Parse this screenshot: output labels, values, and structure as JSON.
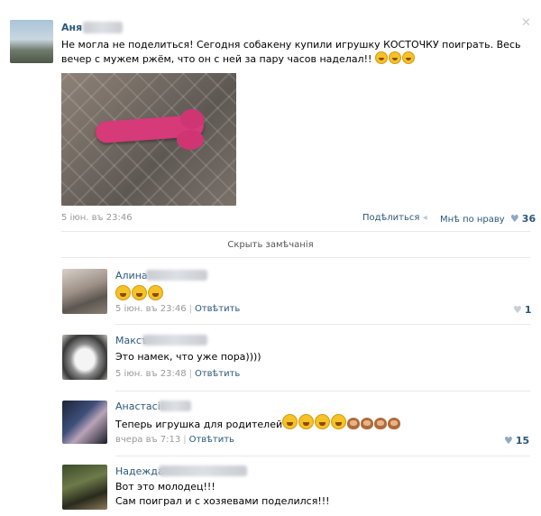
{
  "post": {
    "author": "Аня",
    "text": "Не могла не поделиться! Сегодня собакену купили игрушку КОСТОЧКУ поиграть. Весь вечер с мужем ржём, что он с ней за пару часов наделал!!",
    "emoji_icons": [
      "laughing-emoji",
      "laughing-emoji",
      "laughing-emoji"
    ],
    "date": "5 іюн. въ 23:46",
    "share_label": "Подѣлиться",
    "like_label": "Мнѣ по нраву",
    "like_count": "36",
    "hide_comments": "Скрыть замѣчанія",
    "close_icon": "✕"
  },
  "comments": [
    {
      "name": "Алина",
      "text": "",
      "emoji_count": 3,
      "date": "5 іюн. въ 23:46",
      "reply": "Отвѣтить",
      "likes": "1"
    },
    {
      "name": "Максъ",
      "text": "Это намек, что уже пора))))",
      "date": "5 іюн. въ 23:48",
      "reply": "Отвѣтить",
      "likes": ""
    },
    {
      "name": "Анастасія",
      "text": "Теперь игрушка для родителей",
      "date": "вчера въ 7:13",
      "reply": "Отвѣтить",
      "likes": "15"
    },
    {
      "name": "Надежда",
      "text_line1": "Вот это молодец!!!",
      "text_line2": "Сам поиграл и с хозяевами поделился!!!",
      "date": "",
      "reply": "",
      "likes": ""
    }
  ],
  "colors": {
    "link": "#2b587a",
    "meta": "#999999",
    "heart": "#8fa9c4"
  }
}
